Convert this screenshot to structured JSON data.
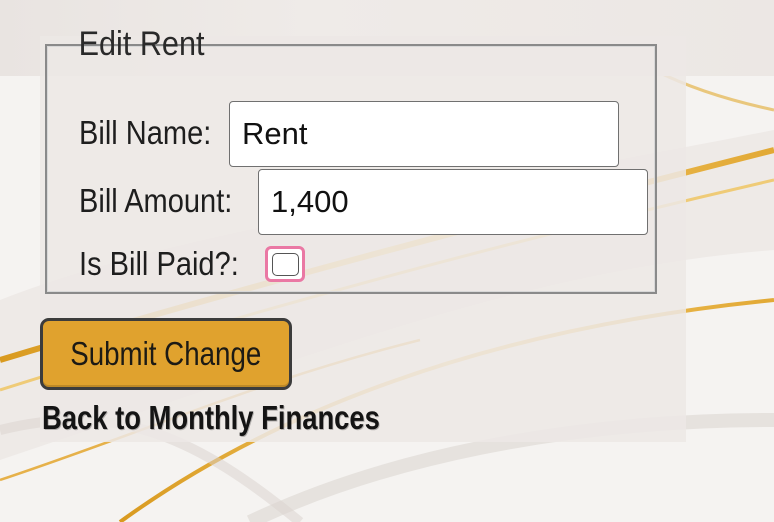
{
  "form": {
    "legend": "Edit Rent",
    "bill_name_label": "Bill Name:",
    "bill_name_value": "Rent",
    "bill_amount_label": "Bill Amount:",
    "bill_amount_value": "1,400",
    "is_paid_label": "Is Bill Paid?:",
    "is_paid_checked": false,
    "submit_label": "Submit Change"
  },
  "nav": {
    "back_link_label": "Back to Monthly Finances"
  },
  "colors": {
    "button_background": "#e0a22e",
    "checkbox_focus_outline": "#ea78a4",
    "gold_swirl": "#e8b84a"
  }
}
